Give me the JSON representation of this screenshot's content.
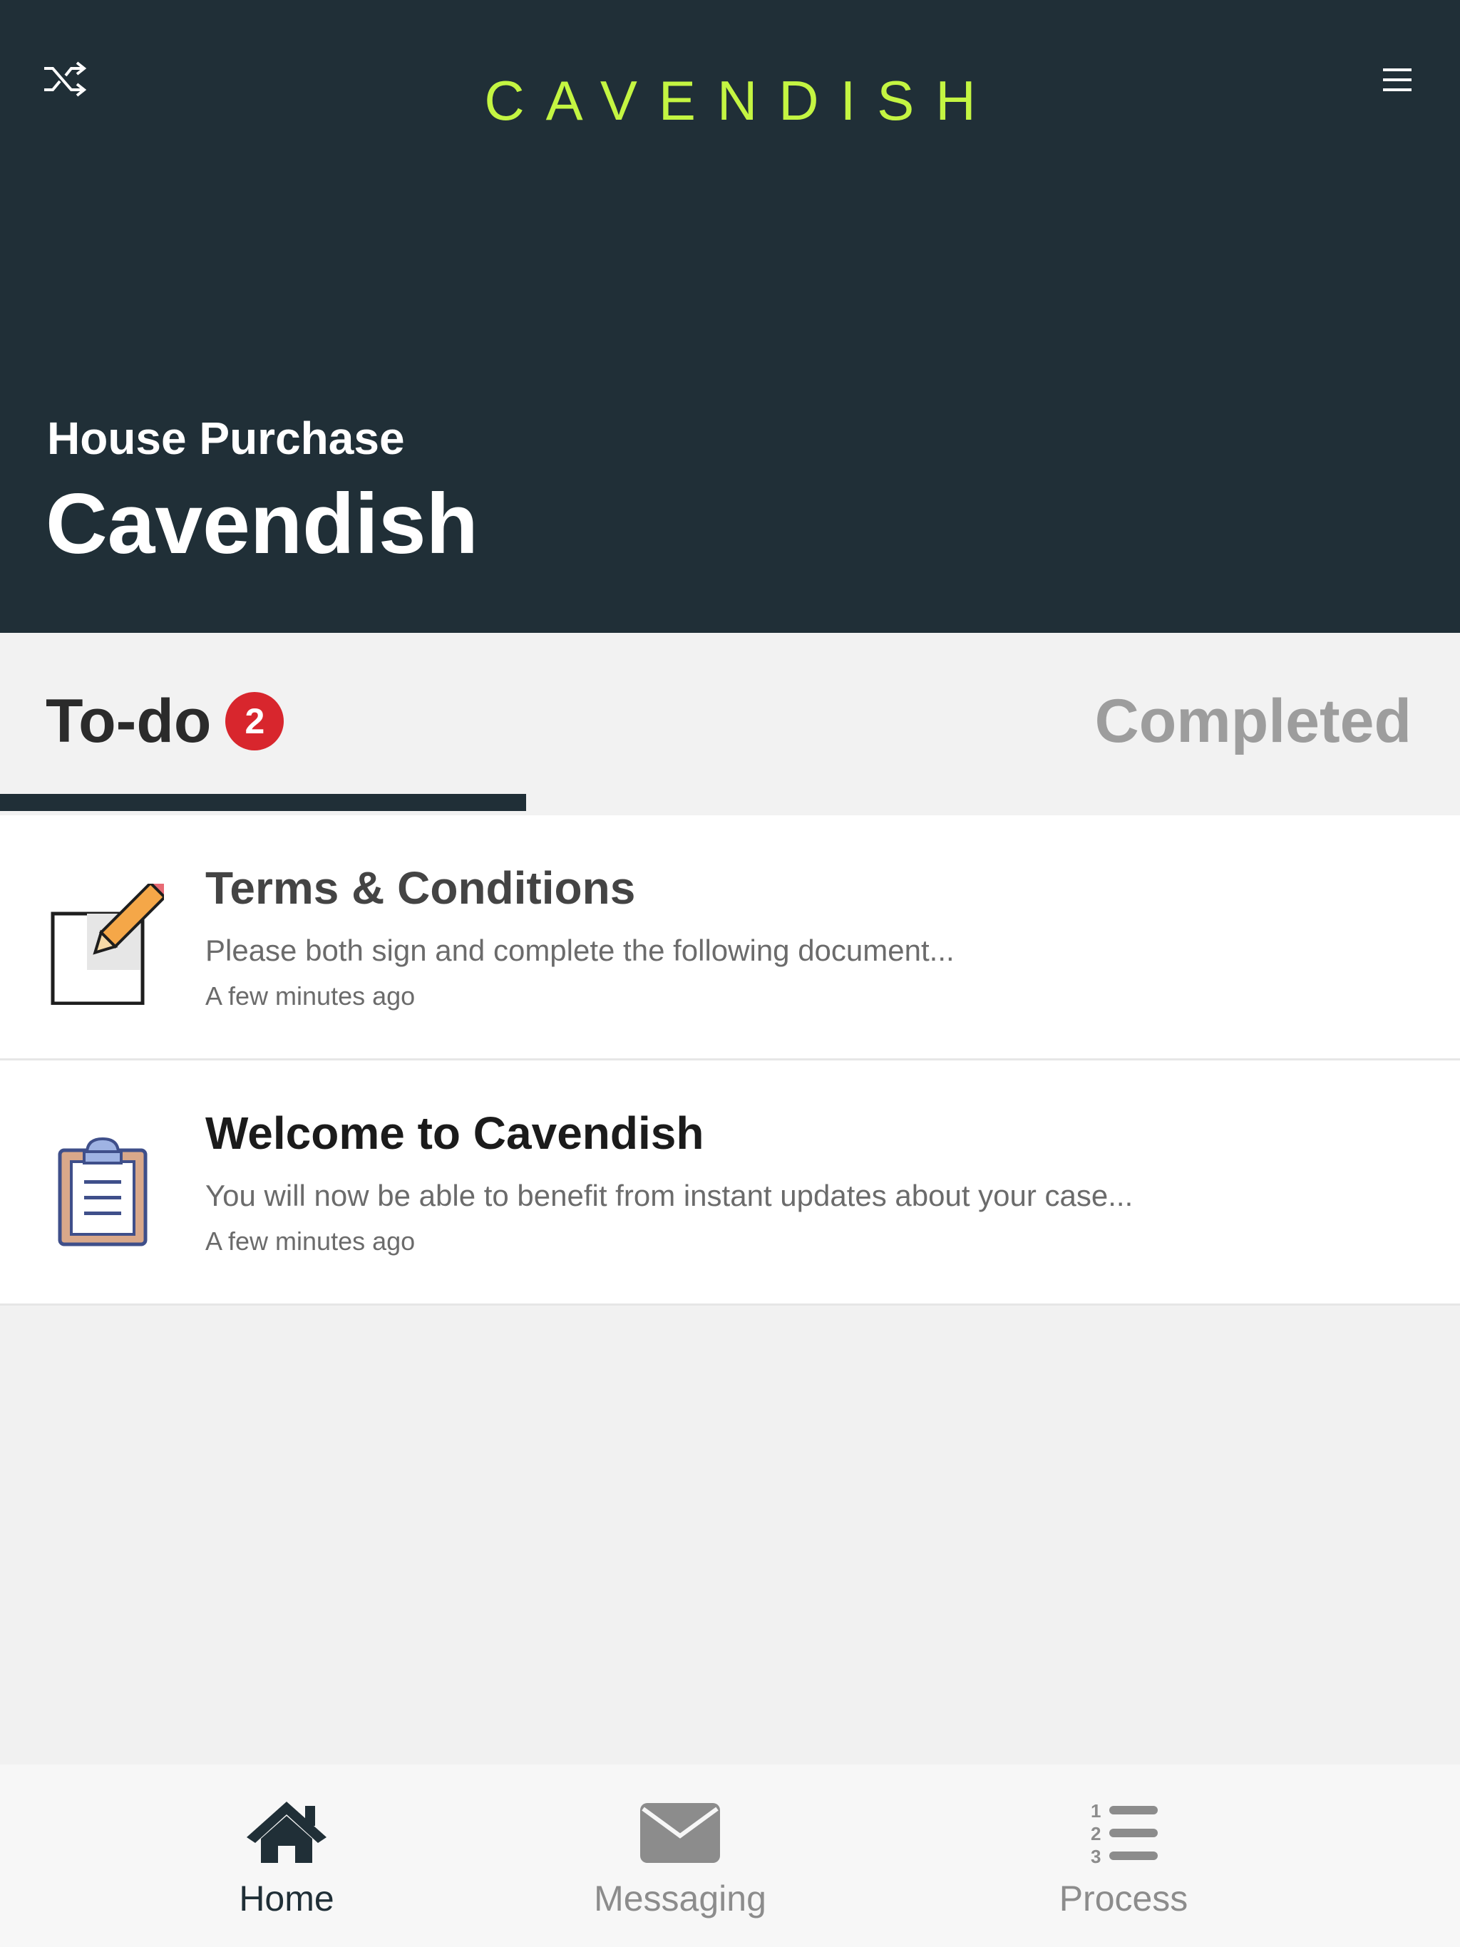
{
  "header": {
    "logo": "CAVENDISH",
    "case_type": "House Purchase",
    "case_name": "Cavendish",
    "icons": {
      "left": "shuffle-icon",
      "right": "hamburger-menu-icon"
    }
  },
  "tabs": {
    "todo_label": "To-do",
    "todo_count": "2",
    "completed_label": "Completed",
    "active": "To-do"
  },
  "items": [
    {
      "title": "Terms & Conditions",
      "description": "Please both sign and complete the following document...",
      "time": "A few minutes ago",
      "icon": "edit-document-icon"
    },
    {
      "title": "Welcome to Cavendish",
      "description": "You will now be able to benefit from instant updates about your case...",
      "time": "A few minutes ago",
      "icon": "clipboard-icon"
    }
  ],
  "nav": {
    "home": "Home",
    "messaging": "Messaging",
    "process": "Process"
  },
  "colors": {
    "header_bg": "#202f37",
    "logo": "#c4f542",
    "badge": "#d8262d",
    "nav_active": "#202f37",
    "nav_inactive": "#8c8c8c"
  }
}
